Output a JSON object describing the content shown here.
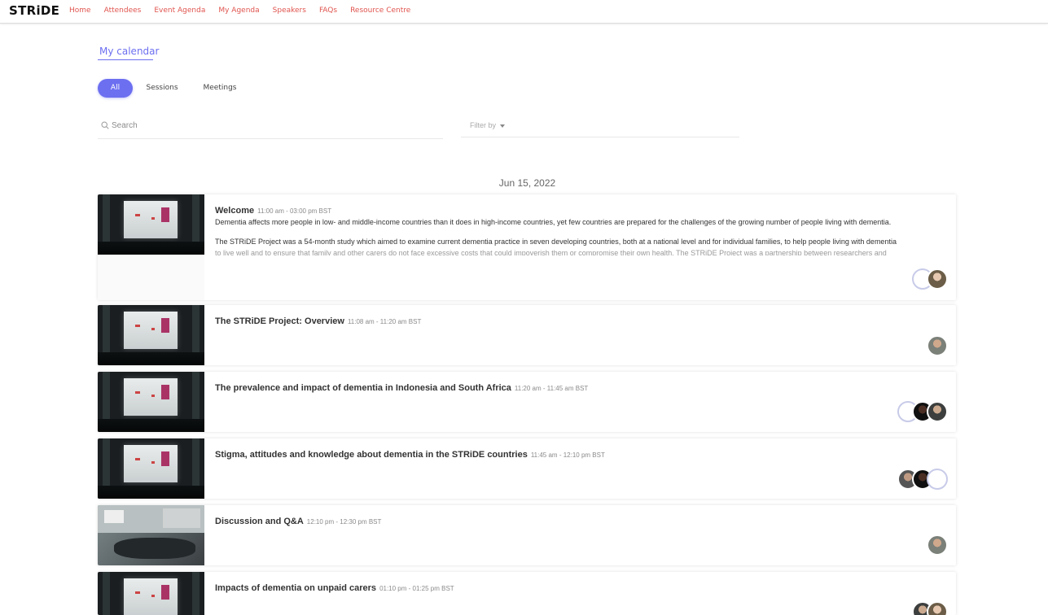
{
  "brand": {
    "logo": "STRiDE",
    "accent": "#6c6ff0",
    "nav_color": "#e0554f"
  },
  "nav": [
    "Home",
    "Attendees",
    "Event Agenda",
    "My Agenda",
    "Speakers",
    "FAQs",
    "Resource Centre"
  ],
  "calendar": {
    "title": "My calendar",
    "tabs": [
      "All",
      "Sessions",
      "Meetings"
    ],
    "active_tab": "All",
    "search_placeholder": "Search",
    "filter_label": "Filter by",
    "date": "Jun 15, 2022"
  },
  "sessions": [
    {
      "title": "Welcome",
      "time": "11:00 am - 03:00 pm BST",
      "desc1": "Dementia affects more people in low- and middle-income countries than it does in high-income countries, yet few countries are prepared for the challenges of the growing number of people living with dementia.",
      "desc2": "The STRiDE Project was a 54-month study which aimed to examine current dementia practice in seven developing countries, both at a national level and for individual families, to help people living with dementia",
      "desc3": "to live well and to ensure that family and other carers do not face excessive costs that could impoverish them or compromise their own health. The STRiDE Project was a partnership between researchers and"
    },
    {
      "title": "The STRiDE Project: Overview",
      "time": "11:08 am - 11:20 am BST"
    },
    {
      "title": "The prevalence and impact of dementia in Indonesia and South Africa",
      "time": "11:20 am - 11:45 am BST"
    },
    {
      "title": "Stigma, attitudes and knowledge about dementia in the STRiDE countries",
      "time": "11:45 am - 12:10 pm BST"
    },
    {
      "title": "Discussion and Q&A",
      "time": "12:10 pm - 12:30 pm BST"
    },
    {
      "title": "Impacts of dementia on unpaid carers",
      "time": "01:10 pm - 01:25 pm BST"
    }
  ]
}
